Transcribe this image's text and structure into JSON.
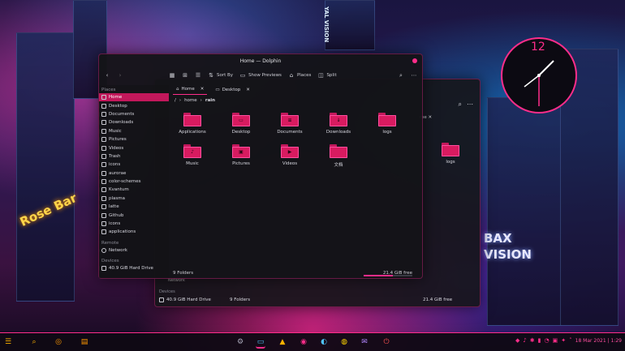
{
  "front_window": {
    "title": "Home — Dolphin",
    "toolbar": {
      "sort_label": "Sort By",
      "previews_label": "Show Previews",
      "places_label": "Places",
      "split_label": "Split"
    },
    "sidebar": {
      "places_header": "Places",
      "items": [
        {
          "label": "Home",
          "icon": "home-icon",
          "active": true
        },
        {
          "label": "Desktop",
          "icon": "desktop-icon"
        },
        {
          "label": "Documents",
          "icon": "documents-icon"
        },
        {
          "label": "Downloads",
          "icon": "downloads-icon"
        },
        {
          "label": "Music",
          "icon": "music-icon"
        },
        {
          "label": "Pictures",
          "icon": "pictures-icon"
        },
        {
          "label": "Videos",
          "icon": "videos-icon"
        },
        {
          "label": "Trash",
          "icon": "trash-icon"
        },
        {
          "label": "icons",
          "icon": "folder-icon"
        },
        {
          "label": "aurorae",
          "icon": "folder-icon"
        },
        {
          "label": "color-schemes",
          "icon": "folder-icon"
        },
        {
          "label": "Kvantum",
          "icon": "folder-icon"
        },
        {
          "label": "plasma",
          "icon": "folder-icon"
        },
        {
          "label": "latte",
          "icon": "folder-icon"
        },
        {
          "label": "Github",
          "icon": "folder-icon"
        },
        {
          "label": "icons",
          "icon": "folder-icon"
        },
        {
          "label": "applications",
          "icon": "folder-icon"
        }
      ],
      "remote_header": "Remote",
      "network_label": "Network",
      "devices_header": "Devices",
      "drive_label": "40.9 GiB Hard Drive"
    },
    "tabs": [
      {
        "label": "Home",
        "active": true
      },
      {
        "label": "Desktop",
        "active": false
      }
    ],
    "breadcrumb": {
      "root": "/",
      "parts": [
        "home",
        "rain"
      ]
    },
    "folders": [
      {
        "name": "Applications",
        "glyph": ""
      },
      {
        "name": "Desktop",
        "glyph": "▭"
      },
      {
        "name": "Documents",
        "glyph": "≡"
      },
      {
        "name": "Downloads",
        "glyph": "↓"
      },
      {
        "name": "logs",
        "glyph": ""
      },
      {
        "name": "Music",
        "glyph": "♪"
      },
      {
        "name": "Pictures",
        "glyph": "▣"
      },
      {
        "name": "Videos",
        "glyph": "▶"
      },
      {
        "name": "文档",
        "glyph": ""
      }
    ],
    "status": {
      "count": "9 Folders",
      "free": "21.4 GiB free",
      "used_fraction": 0.6
    }
  },
  "back_window": {
    "tab_label": "me",
    "folder_name": "logs",
    "network_label": "Network",
    "devices_header": "Devices",
    "drive_label": "40.9 GiB Hard Drive",
    "count": "9 Folders",
    "free": "21.4 GiB free"
  },
  "clock_widget": {
    "time": "12:41",
    "number": "12"
  },
  "wallpaper": {
    "neon_sign_1": "Rose Bar",
    "neon_sign_2": "BAX",
    "neon_sign_3": "VISION",
    "sign_4": "YAL VISION"
  },
  "taskbar": {
    "datetime": "18 Mar 2021 | 1:29",
    "accent": "#ff2d8a"
  }
}
